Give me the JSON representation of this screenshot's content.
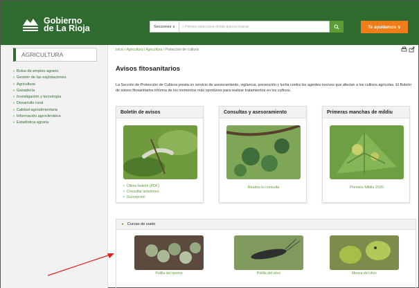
{
  "header": {
    "logo_line1": "Gobierno",
    "logo_line2": "de La Rioja",
    "search_select": "Secciones ∨",
    "search_placeholder": "< Primero seleccione dónde quieres buscar",
    "help_label": "Te ayudamos ∨"
  },
  "sidebar": {
    "title": "AGRICULTURA",
    "items": [
      {
        "label": "Bolsa de empleo agrario"
      },
      {
        "label": "Gestión de las explotaciones"
      },
      {
        "label": "Agricultura"
      },
      {
        "label": "Ganadería"
      },
      {
        "label": "Investigación y tecnología"
      },
      {
        "label": "Desarrollo rural"
      },
      {
        "label": "Calidad agroalimentaria"
      },
      {
        "label": "Información agroclimática"
      },
      {
        "label": "Estadística agraria"
      }
    ]
  },
  "breadcrumb": [
    "Inicio",
    "Agricultura",
    "Agricultura",
    "Protección de cultivos"
  ],
  "main": {
    "title": "Avisos fitosanitarios",
    "intro": "La Sección de Protección de Cultivos presta un servicio de asesoramiento, vigilancia, prevención y lucha contra los agentes nocivos que afectan a los cultivos agrícolas. El Boletín de avisos fitosanitarios informa de los momentos más oportunos para realizar tratamientos en los cultivos."
  },
  "cards": [
    {
      "title": "Boletín de avisos",
      "links": [
        "Último boletín (PDF)",
        "Consultar anteriores",
        "Suscripción"
      ]
    },
    {
      "title": "Consultas y asesoramiento",
      "link": "Realiza tu consulta"
    },
    {
      "title": "Primeras manchas de mildiu",
      "link": "Premios Mildiu 2020"
    }
  ],
  "curvas": {
    "title": "Curvas de vuelo",
    "items": [
      {
        "label": "Polilla del racimo"
      },
      {
        "label": "Polilla del olivo"
      },
      {
        "label": "Mosca del olivo"
      }
    ]
  },
  "colors": {
    "header": "#2f6b2f",
    "accent": "#5c9e35",
    "help": "#ef7d1a",
    "arrow": "#e02020"
  }
}
